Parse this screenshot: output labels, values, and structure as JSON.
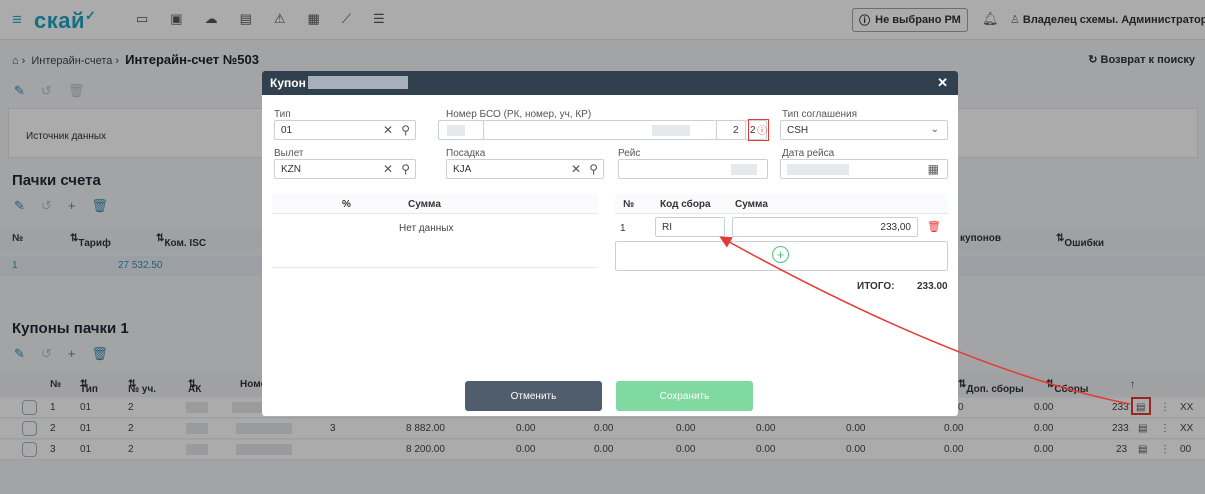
{
  "app": {
    "logo": "скай"
  },
  "header": {
    "pm_label": "Не выбрано РМ",
    "user_label": "Владелец схемы. Администратор"
  },
  "breadcrumb": {
    "root": "Интерайн-счета",
    "current": "Интерайн-счет №503"
  },
  "back_label": "Возврат к поиску",
  "source_label": "Источник данных",
  "packs": {
    "title": "Пачки счета",
    "columns": [
      "№",
      "Тариф",
      "Ком. ISC",
      "купонов",
      "Ошибки"
    ],
    "row": {
      "num": "1",
      "tariff": "27 532.50"
    }
  },
  "coupons": {
    "title": "Купоны пачки 1",
    "columns": [
      "№",
      "Тип",
      "№ уч.",
      "АК",
      "Номе",
      "Доп. сборы",
      "Сборы"
    ],
    "rows": [
      {
        "num": "1",
        "type": "01",
        "seg": "2",
        "c1": "",
        "c2": "",
        "c3": "",
        "c4": "",
        "c5": "",
        "c6": "",
        "c7": "",
        "fee": "0",
        "extra": "0.00",
        "total": "233",
        "tail": "XX"
      },
      {
        "num": "2",
        "type": "01",
        "seg": "2",
        "c1": "3",
        "c2": "8 882.00",
        "c3": "0.00",
        "c4": "0.00",
        "c5": "0.00",
        "c6": "0.00",
        "c7": "0.00",
        "fee": "0.00",
        "extra": "0.00",
        "total": "233",
        "tail": "XX"
      },
      {
        "num": "3",
        "type": "01",
        "seg": "2",
        "c1": "",
        "c2": "8 200.00",
        "c3": "0.00",
        "c4": "0.00",
        "c5": "0.00",
        "c6": "0.00",
        "c7": "0.00",
        "fee": "0.00",
        "extra": "0.00",
        "total": "23",
        "tail": "00"
      }
    ]
  },
  "modal": {
    "title": "Купон",
    "type_label": "Тип",
    "type_value": "01",
    "bso_label": "Номер БСО (РК, номер, уч, КР)",
    "bso_seg": "2",
    "bso_kr": "2",
    "agreement_label": "Тип соглашения",
    "agreement_value": "CSH",
    "dep_label": "Вылет",
    "dep_value": "KZN",
    "arr_label": "Посадка",
    "arr_value": "KJA",
    "flight_label": "Рейс",
    "flight_value": "",
    "date_label": "Дата рейса",
    "date_value": "",
    "pct_head": "%",
    "sum_head": "Сумма",
    "no_data": "Нет данных",
    "fees": {
      "num_head": "№",
      "code_head": "Код сбора",
      "sum_head": "Сумма",
      "rows": [
        {
          "num": "1",
          "code": "RI",
          "sum": "233,00"
        }
      ]
    },
    "total_label": "ИТОГО:",
    "total_value": "233.00",
    "cancel_label": "Отменить",
    "save_label": "Сохранить"
  },
  "colors": {
    "accent": "#1fa6c3",
    "modal_header": "#31404f",
    "cancel": "#4f5d6c",
    "save": "#7fd9a1",
    "error": "#e53935"
  }
}
